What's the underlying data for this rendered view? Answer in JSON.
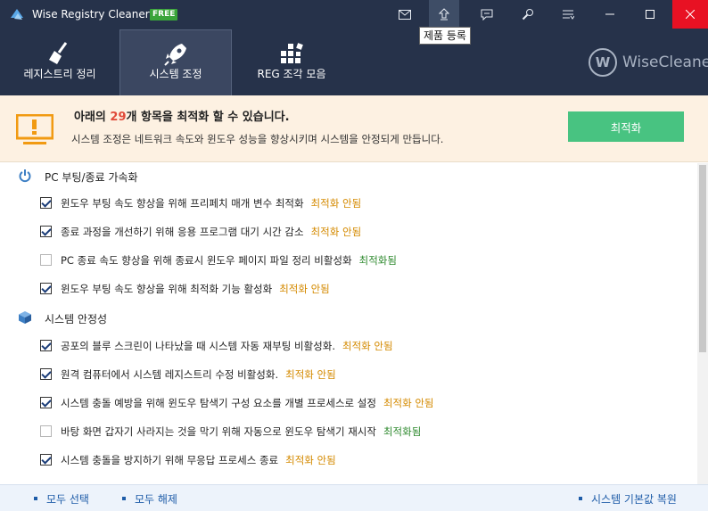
{
  "app": {
    "title": "Wise Registry Cleaner X",
    "badge": "FREE"
  },
  "tooltip": "제품 등록",
  "nav": {
    "tabs": [
      {
        "label": "레지스트리 정리",
        "icon": "broom-icon"
      },
      {
        "label": "시스템 조정",
        "icon": "rocket-icon",
        "active": true
      },
      {
        "label": "REG 조각 모음",
        "icon": "defrag-icon"
      }
    ]
  },
  "brand": {
    "name": "WiseCleaner",
    "letter": "W"
  },
  "banner": {
    "title_prefix": "아래의 ",
    "count": "29",
    "title_suffix": "개 항목을 최적화 할 수 있습니다.",
    "subtitle": "시스템 조정은 네트워크 속도와 윈도우 성능을 향상시키며 시스템을 안정되게 만듭니다.",
    "button": "최적화"
  },
  "sections": [
    {
      "label": "PC 부팅/종료 가속화",
      "icon": "power-icon",
      "items": [
        {
          "text": "윈도우 부팅 속도 향상을 위해 프리페치 매개 변수 최적화",
          "status": "최적화 안됨",
          "checked": true
        },
        {
          "text": "종료 과정을 개선하기 위해 응용 프로그램 대기 시간 감소",
          "status": "최적화 안됨",
          "checked": true
        },
        {
          "text": "PC 종료 속도 향상을 위해 종료시 윈도우 페이지 파일 정리 비활성화",
          "status": "최적화됨",
          "checked": false
        },
        {
          "text": "윈도우 부팅 속도 향상을 위해 최적화 기능 활성화",
          "status": "최적화 안됨",
          "checked": true
        }
      ]
    },
    {
      "label": "시스템 안정성",
      "icon": "cube-icon",
      "items": [
        {
          "text": "공포의 블루 스크린이 나타났을 때 시스템 자동 재부팅 비활성화.",
          "status": "최적화 안됨",
          "checked": true
        },
        {
          "text": "원격 컴퓨터에서 시스템 레지스트리 수정 비활성화.",
          "status": "최적화 안됨",
          "checked": true
        },
        {
          "text": "시스템 충돌 예방을 위해 윈도우 탐색기 구성 요소를 개별 프로세스로 설정",
          "status": "최적화 안됨",
          "checked": true
        },
        {
          "text": "바탕 화면 갑자기 사라지는 것을 막기 위해 자동으로 윈도우 탐색기 재시작",
          "status": "최적화됨",
          "checked": false
        },
        {
          "text": "시스템 충돌을 방지하기 위해 무응답 프로세스 종료",
          "status": "최적화 안됨",
          "checked": true
        }
      ]
    }
  ],
  "footer": {
    "select_all": "모두 선택",
    "deselect_all": "모두 해제",
    "restore_default": "시스템 기본값 복원"
  },
  "colors": {
    "header_bg": "#26324a",
    "accent_green": "#48c381",
    "pending": "#d48a00",
    "done": "#2f8a2f"
  }
}
